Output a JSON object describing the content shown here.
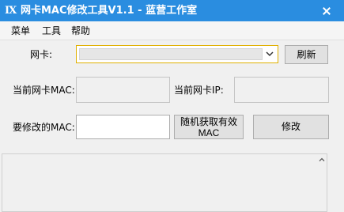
{
  "window": {
    "title": "网卡MAC修改工具V1.1 - 蓝营工作室",
    "icon_text": "IX"
  },
  "menu": {
    "items": [
      "菜单",
      "工具",
      "帮助"
    ]
  },
  "form": {
    "nic_label": "网卡:",
    "nic_value": "",
    "refresh_button": "刷新",
    "current_mac_label": "当前网卡MAC:",
    "current_mac_value": "",
    "current_ip_label": "当前网卡IP:",
    "current_ip_value": "",
    "new_mac_label": "要修改的MAC:",
    "new_mac_value": "",
    "random_mac_button_line1": "随机获取有效",
    "random_mac_button_line2": "MAC",
    "modify_button": "修改"
  },
  "log": {
    "text": ""
  },
  "icons": {
    "app": "app-logo-icon",
    "close": "close-icon",
    "dropdown": "chevron-down-icon",
    "scroll_up": "scroll-up-arrow-icon"
  }
}
